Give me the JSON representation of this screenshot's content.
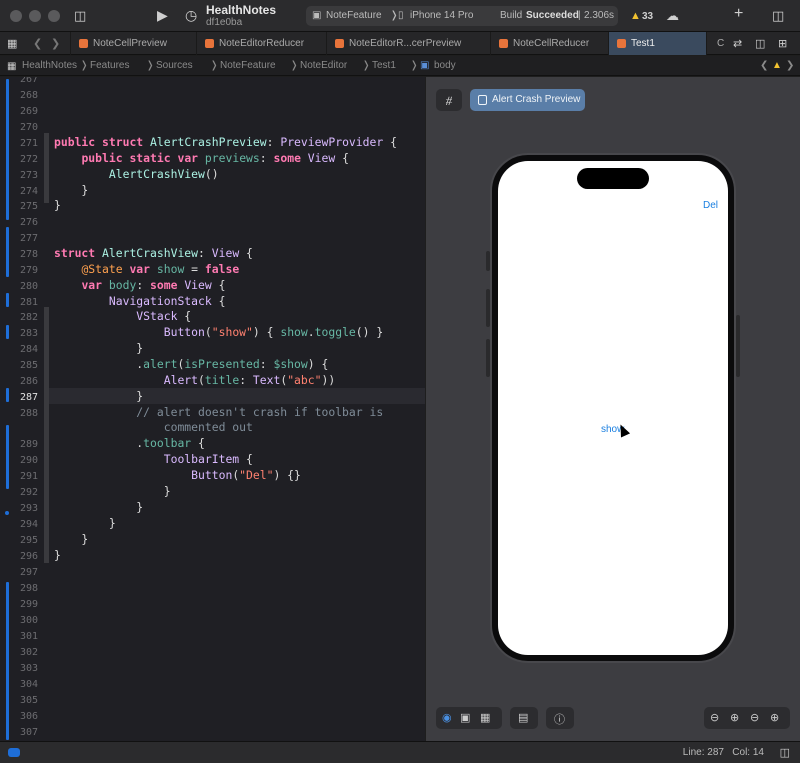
{
  "titlebar": {
    "project_name": "HealthNotes",
    "branch": "df1e0ba",
    "scheme": "NoteFeature",
    "device": "iPhone 14 Pro",
    "build_status_prefix": "Build",
    "build_status": "Succeeded",
    "build_time": "2.306s",
    "warnings": "33"
  },
  "tabs": [
    {
      "label": "NoteCellPreview"
    },
    {
      "label": "NoteEditorReducer"
    },
    {
      "label": "NoteEditorR...cerPreview"
    },
    {
      "label": "NoteCellReducer"
    },
    {
      "label": "Test1"
    },
    {
      "label": "C"
    }
  ],
  "breadcrumb": [
    "HealthNotes",
    "Features",
    "Sources",
    "NoteFeature",
    "NoteEditor",
    "Test1",
    "body"
  ],
  "editor": {
    "lines": [
      {
        "n": "267",
        "text": ""
      },
      {
        "n": "268",
        "text": ""
      },
      {
        "n": "269",
        "text": ""
      },
      {
        "n": "270",
        "text": ""
      },
      {
        "n": "271",
        "text": "public struct AlertCrashPreview: PreviewProvider {"
      },
      {
        "n": "272",
        "text": "    public static var previews: some View {"
      },
      {
        "n": "273",
        "text": "        AlertCrashView()"
      },
      {
        "n": "274",
        "text": "    }"
      },
      {
        "n": "275",
        "text": "}"
      },
      {
        "n": "276",
        "text": ""
      },
      {
        "n": "277",
        "text": ""
      },
      {
        "n": "278",
        "text": "struct AlertCrashView: View {"
      },
      {
        "n": "279",
        "text": "    @State var show = false"
      },
      {
        "n": "280",
        "text": "    var body: some View {"
      },
      {
        "n": "281",
        "text": "        NavigationStack {"
      },
      {
        "n": "282",
        "text": "            VStack {"
      },
      {
        "n": "283",
        "text": "                Button(\"show\") { show.toggle() }"
      },
      {
        "n": "284",
        "text": "            }"
      },
      {
        "n": "285",
        "text": "            .alert(isPresented: $show) {"
      },
      {
        "n": "286",
        "text": "                Alert(title: Text(\"abc\"))"
      },
      {
        "n": "287",
        "text": "            }"
      },
      {
        "n": "288",
        "text": "            // alert doesn't crash if toolbar is"
      },
      {
        "n": "",
        "text": "                commented out"
      },
      {
        "n": "289",
        "text": "            .toolbar {"
      },
      {
        "n": "290",
        "text": "                ToolbarItem {"
      },
      {
        "n": "291",
        "text": "                    Button(\"Del\") {}"
      },
      {
        "n": "292",
        "text": "                }"
      },
      {
        "n": "293",
        "text": "            }"
      },
      {
        "n": "294",
        "text": "        }"
      },
      {
        "n": "295",
        "text": "    }"
      },
      {
        "n": "296",
        "text": "}"
      },
      {
        "n": "297",
        "text": ""
      },
      {
        "n": "298",
        "text": ""
      },
      {
        "n": "299",
        "text": ""
      },
      {
        "n": "300",
        "text": ""
      },
      {
        "n": "301",
        "text": ""
      },
      {
        "n": "302",
        "text": ""
      },
      {
        "n": "303",
        "text": ""
      },
      {
        "n": "304",
        "text": ""
      },
      {
        "n": "305",
        "text": ""
      },
      {
        "n": "306",
        "text": ""
      },
      {
        "n": "307",
        "text": ""
      }
    ],
    "current_line": "287"
  },
  "canvas": {
    "preview_tab_label": "Alert Crash Preview",
    "toolbar_button_label": "Del",
    "show_button_label": "show"
  },
  "status": {
    "line_label": "Line:",
    "line": "287",
    "col_label": "Col:",
    "col": "14"
  }
}
